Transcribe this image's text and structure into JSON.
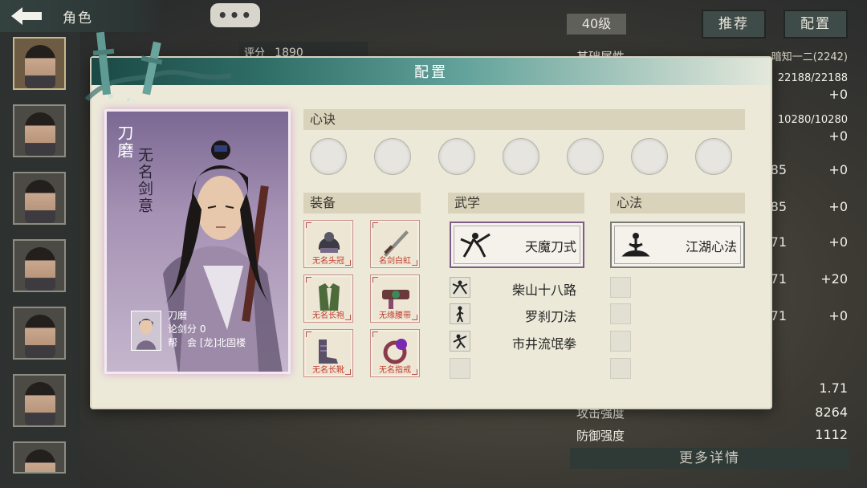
{
  "topbar": {
    "title": "角色",
    "chat_glyph": "•••"
  },
  "score": {
    "label": "评分",
    "value": "1890"
  },
  "level": "40级",
  "buttons": {
    "recommend": "推荐",
    "config": "配置"
  },
  "right_panel": {
    "section_title": "基础属性",
    "owner": "暗知一二(2242)",
    "rows": [
      {
        "value": "22188/22188",
        "delta": "+0"
      },
      {
        "value": "10280/10280",
        "delta": "+0"
      },
      {
        "value": "85",
        "delta": "+0"
      },
      {
        "value": "85",
        "delta": "+0"
      },
      {
        "value": "71",
        "delta": "+0"
      },
      {
        "value": "71",
        "delta": "+20"
      },
      {
        "value": "71",
        "delta": "+0"
      }
    ],
    "stat_value_1": "1.71",
    "attack_label": "攻击强度",
    "attack_value": "8264",
    "defense_label": "防御强度",
    "defense_value": "1112",
    "more": "更多详情"
  },
  "modal": {
    "title": "配置",
    "character": {
      "name": "刀磨",
      "title": "无名剑意",
      "info_name": "刀磨",
      "info_score": "论剑分 0",
      "info_guild": "帮　会 [龙]北固楼"
    },
    "xinjue": {
      "header": "心诀",
      "slots": 7
    },
    "equipment": {
      "header": "装备",
      "items": [
        {
          "label": "无名头冠",
          "icon": "helmet-icon"
        },
        {
          "label": "名剑白虹",
          "icon": "sword-icon"
        },
        {
          "label": "无名长袍",
          "icon": "robe-icon"
        },
        {
          "label": "无缘腰带",
          "icon": "belt-icon"
        },
        {
          "label": "无名长靴",
          "icon": "boots-icon"
        },
        {
          "label": "无名指戒",
          "icon": "ring-icon"
        }
      ]
    },
    "wuxue": {
      "header": "武学",
      "main": "天魔刀式",
      "list": [
        "柴山十八路",
        "罗刹刀法",
        "市井流氓拳"
      ]
    },
    "xinfa": {
      "header": "心法",
      "main": "江湖心法"
    }
  },
  "colors": {
    "header_teal": "#2f6d67",
    "card_purple": "#a692b4",
    "equip_label": "#c23a2c"
  }
}
